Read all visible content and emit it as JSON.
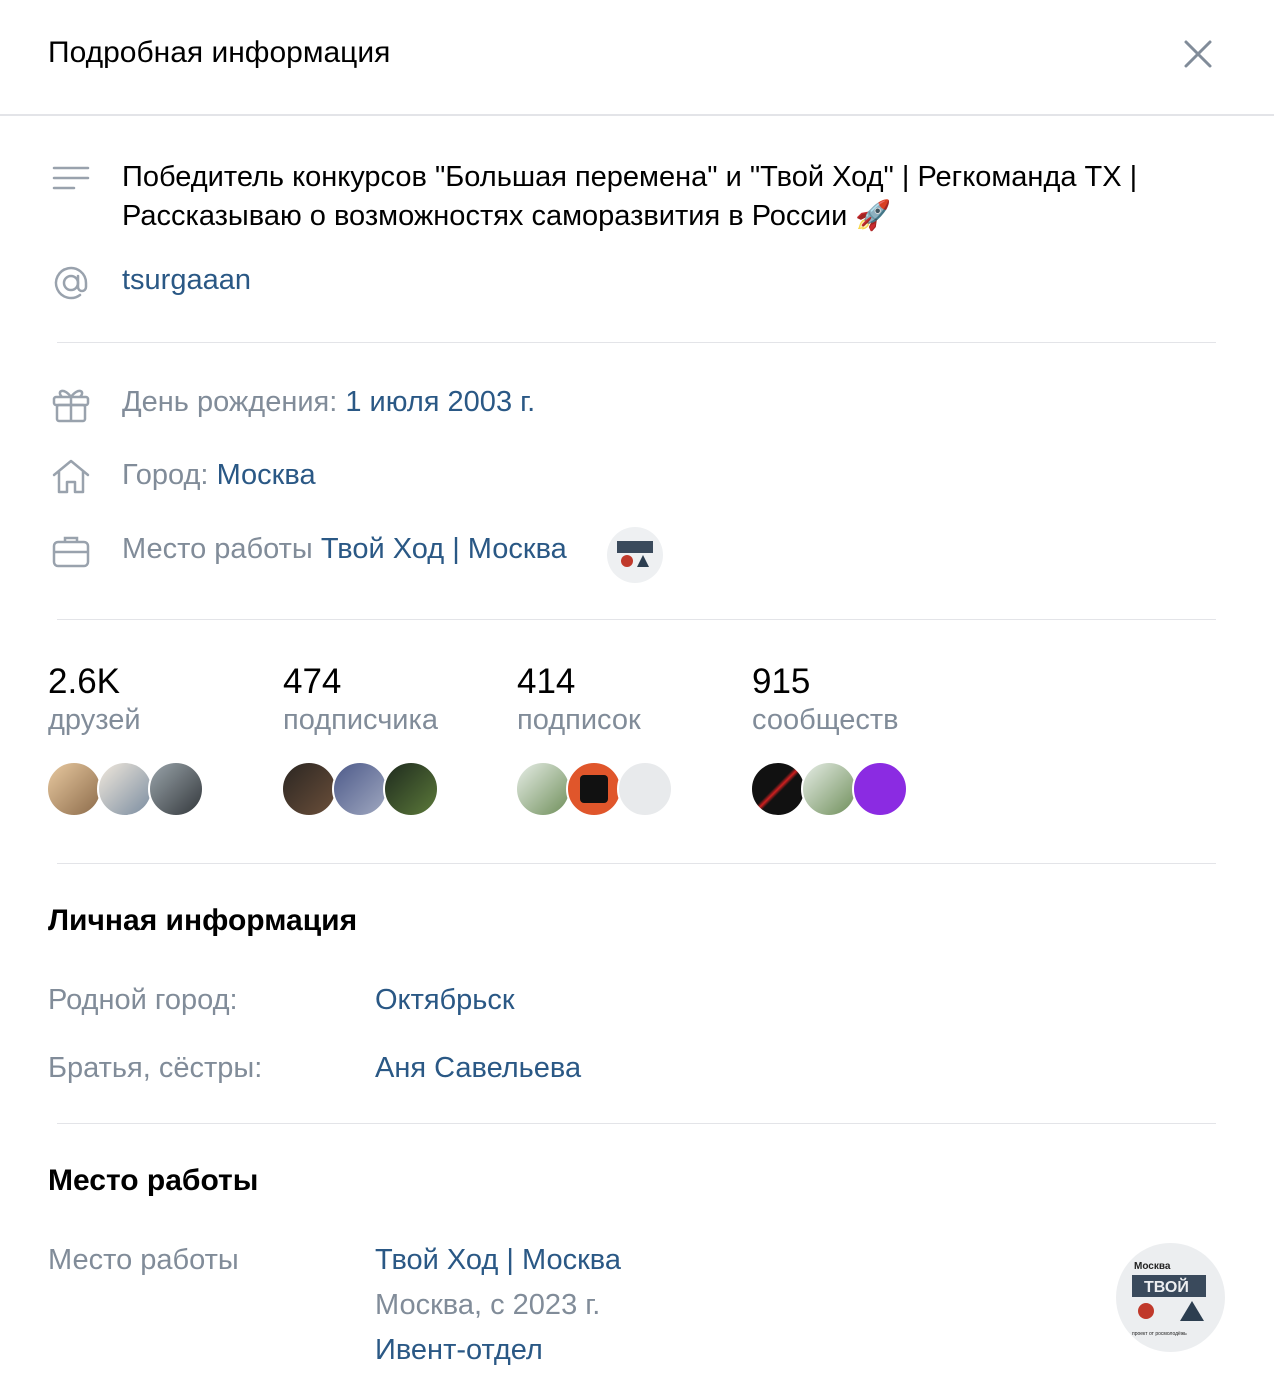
{
  "modal": {
    "title": "Подробная информация",
    "close_icon": "close-icon"
  },
  "status": "Победитель конкурсов \"Большая перемена\" и \"Твой Ход\" | Регкоманда ТХ | Рассказываю о возможностях саморазвития в России 🚀",
  "status_line1": "Победитель конкурсов \"Большая перемена\" и \"Твой Ход\" | Регкоманда ТХ |",
  "status_line2": "Рассказываю о возможностях саморазвития в России 🚀",
  "username": "tsurgaaan",
  "birthday": {
    "label": "День рождения:",
    "value": "1 июля 2003 г."
  },
  "city": {
    "label": "Город:",
    "value": "Москва"
  },
  "work": {
    "label": "Место работы",
    "value": "Твой Ход | Москва"
  },
  "stats": [
    {
      "num": "2.6K",
      "label": "друзей"
    },
    {
      "num": "474",
      "label": "подписчика"
    },
    {
      "num": "414",
      "label": "подписок"
    },
    {
      "num": "915",
      "label": "сообществ"
    }
  ],
  "personal": {
    "heading": "Личная информация",
    "hometown_label": "Родной город:",
    "hometown_value": "Октябрьск",
    "siblings_label": "Братья, сёстры:",
    "siblings_value": "Аня Савельева"
  },
  "career": {
    "heading": "Место работы",
    "label": "Место работы",
    "org": "Твой Ход | Москва",
    "period": "Москва, с 2023 г.",
    "position": "Ивент-отдел",
    "logo_text": [
      "Москва",
      "ТВОЙ",
      "проект от росмолодёжь"
    ]
  },
  "colors": {
    "link": "#2a5885",
    "secondary": "#818c99",
    "separator": "#e3e4e8"
  }
}
